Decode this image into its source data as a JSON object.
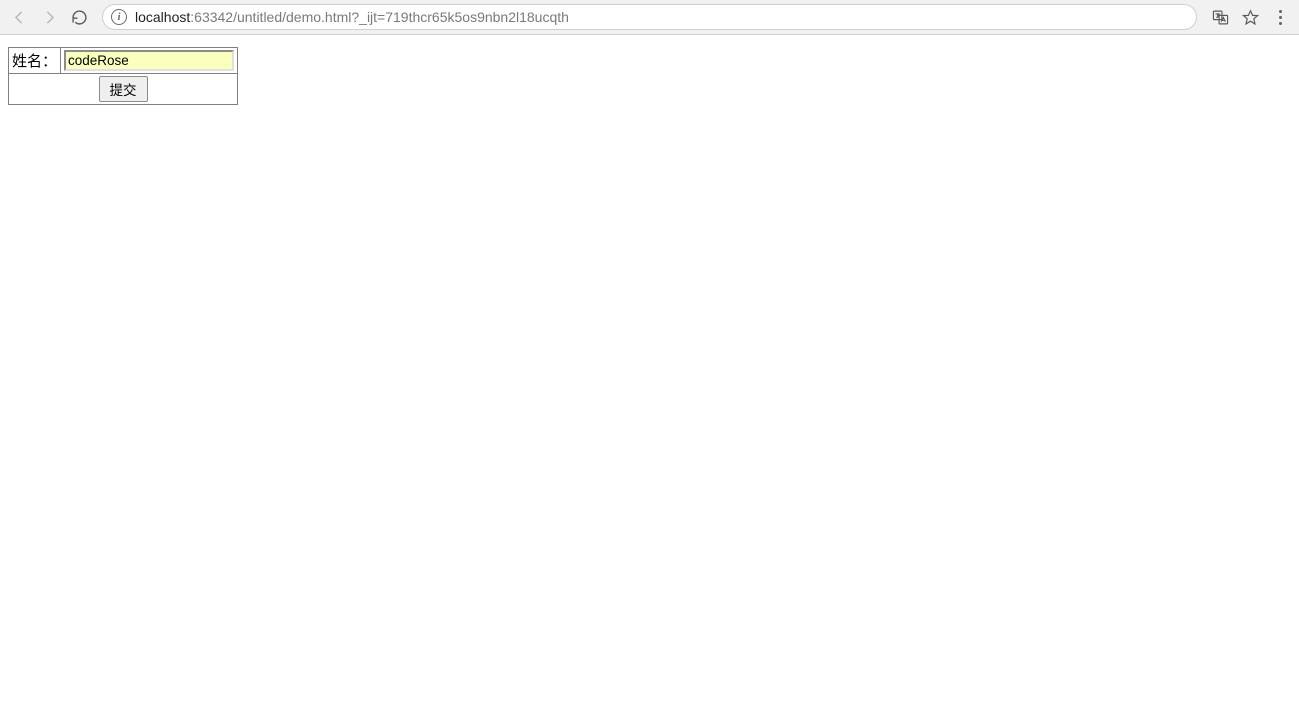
{
  "browser": {
    "url_host": "localhost",
    "url_path": ":63342/untitled/demo.html?_ijt=719thcr65k5os9nbn2l18ucqth"
  },
  "form": {
    "name_label": "姓名：",
    "name_value": "codeRose",
    "submit_label": "提交"
  }
}
